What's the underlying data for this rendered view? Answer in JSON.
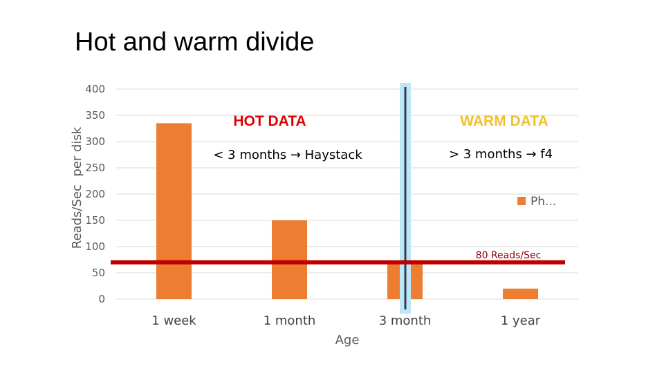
{
  "slide": {
    "title": "Hot and warm divide"
  },
  "chart_data": {
    "type": "bar",
    "title": "Hot and warm divide",
    "categories": [
      "1 week",
      "1 month",
      "3 month",
      "1 year"
    ],
    "series": [
      {
        "name": "Ph...",
        "values": [
          335,
          150,
          72,
          20
        ],
        "color": "#ed7d31"
      }
    ],
    "xlabel": "Age",
    "ylabel": "Reads/Sec  per disk",
    "ylim": [
      0,
      400
    ],
    "yticks": [
      0,
      50,
      100,
      150,
      200,
      250,
      300,
      350,
      400
    ],
    "grid": true,
    "legend": {
      "position": "right",
      "entries": [
        "Ph..."
      ]
    },
    "threshold": {
      "value": 70,
      "label": "80 Reads/Sec",
      "color": "#c00000"
    },
    "divider": {
      "between": [
        "3 month"
      ],
      "line_color": "#333f4f",
      "highlight_color": "#bde7f7"
    },
    "annotations": [
      {
        "text": "HOT DATA",
        "color": "#e00000"
      },
      {
        "text": "< 3 months → Haystack",
        "color": "#000000"
      },
      {
        "text": "WARM DATA",
        "color": "#f2c12e"
      },
      {
        "text": "> 3 months → f4",
        "color": "#000000"
      }
    ]
  }
}
